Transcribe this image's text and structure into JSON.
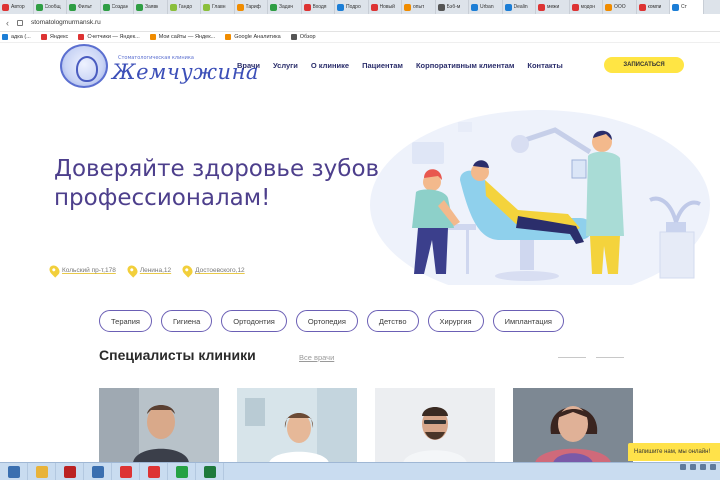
{
  "browser": {
    "tabs": [
      {
        "label": "Автор",
        "color": "#d33"
      },
      {
        "label": "Сообщ",
        "color": "#2f9e44"
      },
      {
        "label": "Фильт",
        "color": "#2f9e44"
      },
      {
        "label": "Создан",
        "color": "#2f9e44"
      },
      {
        "label": "Заявк",
        "color": "#2f9e44"
      },
      {
        "label": "Гандо",
        "color": "#8bbf3b"
      },
      {
        "label": "Главн",
        "color": "#8bbf3b"
      },
      {
        "label": "Тариф",
        "color": "#f08c00"
      },
      {
        "label": "Задач",
        "color": "#2f9e44"
      },
      {
        "label": "Входя",
        "color": "#d33"
      },
      {
        "label": "Подро",
        "color": "#1c7ed6"
      },
      {
        "label": "Новый",
        "color": "#d33"
      },
      {
        "label": "опыт",
        "color": "#f08c00"
      },
      {
        "label": "Бэб-м",
        "color": "#555"
      },
      {
        "label": "Urban",
        "color": "#1c7ed6"
      },
      {
        "label": "Dealin",
        "color": "#1c7ed6"
      },
      {
        "label": "межи",
        "color": "#d33"
      },
      {
        "label": "модон",
        "color": "#d33"
      },
      {
        "label": "ООО",
        "color": "#f08c00"
      },
      {
        "label": "компи",
        "color": "#d33"
      },
      {
        "label": "Ст",
        "color": "#1c7ed6",
        "active": true
      }
    ],
    "url": "stomatologmurmansk.ru",
    "bookmarks": [
      {
        "label": "адка (...",
        "color": "#1c7ed6"
      },
      {
        "label": "Яндекс",
        "color": "#d33"
      },
      {
        "label": "Счетчики — Яндек...",
        "color": "#d33"
      },
      {
        "label": "Мои сайты — Яндек...",
        "color": "#f08c00"
      },
      {
        "label": "Google Аналитика",
        "color": "#f08c00"
      },
      {
        "label": "Обзор",
        "color": "#555"
      }
    ]
  },
  "site": {
    "brand_small": "Стоматологическая клиника",
    "brand_name": "Жемчужина",
    "nav": [
      "Врачи",
      "Услуги",
      "О клинике",
      "Пациентам",
      "Корпоративным клиентам",
      "Контакты"
    ],
    "cta": "ЗАПИСАТЬСЯ",
    "hero_title": "Доверяйте здоровье зубов профессионалам!",
    "addresses": [
      "Кольский пр-т,178",
      "Ленина,12",
      "Достоевского,12"
    ],
    "services": [
      "Терапия",
      "Гигиена",
      "Ортодонтия",
      "Ортопедия",
      "Детство",
      "Хирургия",
      "Имплантация"
    ],
    "specialists_title": "Специалисты клиники",
    "specialists_link": "Все врачи",
    "chat": "Напишите нам, мы онлайн!"
  },
  "taskbar": {
    "apps": [
      {
        "name": "file-explorer",
        "color": "#e8b33a"
      },
      {
        "name": "filezilla",
        "color": "#b22"
      },
      {
        "name": "window",
        "color": "#3a6fb0"
      },
      {
        "name": "opera",
        "color": "#d33"
      },
      {
        "name": "yandex-browser",
        "color": "#d33"
      },
      {
        "name": "whatsapp",
        "color": "#25a244"
      },
      {
        "name": "excel",
        "color": "#1f7a3c"
      }
    ]
  },
  "colors": {
    "accent": "#ffe544",
    "brand": "#3c4fb8",
    "heading": "#4d3f8c",
    "chip_border": "#6b5fb5"
  }
}
